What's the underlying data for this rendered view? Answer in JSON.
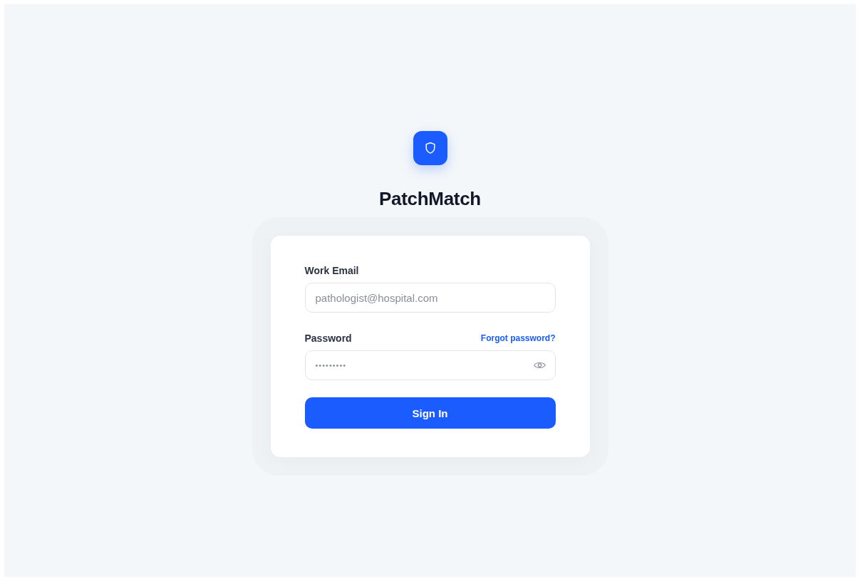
{
  "app": {
    "title": "PatchMatch"
  },
  "form": {
    "email": {
      "label": "Work Email",
      "placeholder": "pathologist@hospital.com"
    },
    "password": {
      "label": "Password",
      "placeholder": "•••••••••",
      "forgot_link": "Forgot password?"
    },
    "submit": "Sign In"
  }
}
